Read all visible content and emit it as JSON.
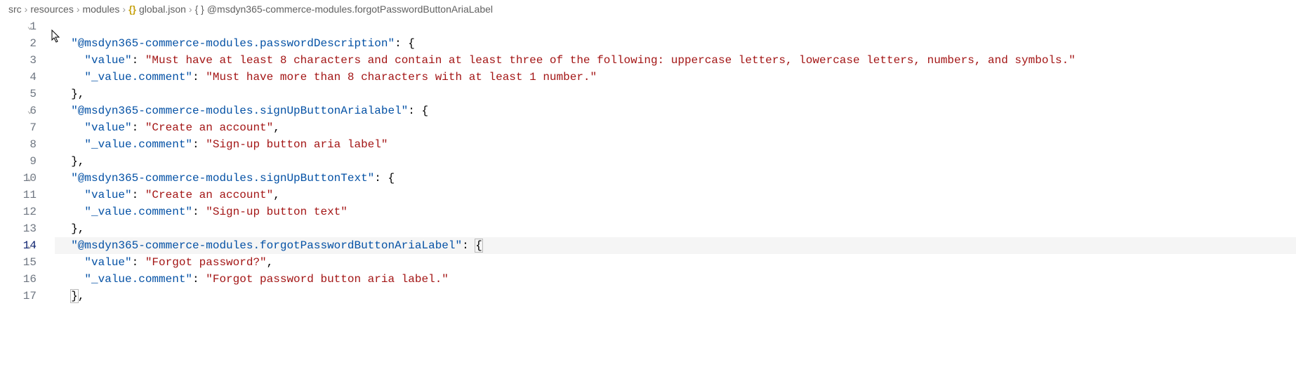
{
  "breadcrumb": {
    "items": [
      {
        "label": "src"
      },
      {
        "label": "resources"
      },
      {
        "label": "modules"
      },
      {
        "label": "global.json",
        "icon": "{}"
      },
      {
        "label": "@msdyn365-commerce-modules.forgotPasswordButtonAriaLabel",
        "icon": "{ }"
      }
    ]
  },
  "editor": {
    "lines": [
      {
        "num": "1",
        "fold": true,
        "tokens": []
      },
      {
        "num": "2",
        "fold": false,
        "tokens": [
          {
            "t": "  ",
            "c": "plain"
          },
          {
            "t": "\"@msdyn365-commerce-modules.passwordDescription\"",
            "c": "key"
          },
          {
            "t": ": ",
            "c": "punct"
          },
          {
            "t": "{",
            "c": "punct"
          }
        ]
      },
      {
        "num": "3",
        "fold": false,
        "tokens": [
          {
            "t": "    ",
            "c": "plain"
          },
          {
            "t": "\"value\"",
            "c": "key"
          },
          {
            "t": ": ",
            "c": "punct"
          },
          {
            "t": "\"Must have at least 8 characters and contain at least three of the following: uppercase letters, lowercase letters, numbers, and symbols.\"",
            "c": "string"
          }
        ]
      },
      {
        "num": "4",
        "fold": false,
        "tokens": [
          {
            "t": "    ",
            "c": "plain"
          },
          {
            "t": "\"_value.comment\"",
            "c": "key"
          },
          {
            "t": ": ",
            "c": "punct"
          },
          {
            "t": "\"Must have more than 8 characters with at least 1 number.\"",
            "c": "string"
          }
        ]
      },
      {
        "num": "5",
        "fold": false,
        "tokens": [
          {
            "t": "  ",
            "c": "plain"
          },
          {
            "t": "},",
            "c": "punct"
          }
        ]
      },
      {
        "num": "6",
        "fold": true,
        "tokens": [
          {
            "t": "  ",
            "c": "plain"
          },
          {
            "t": "\"@msdyn365-commerce-modules.signUpButtonArialabel\"",
            "c": "key"
          },
          {
            "t": ": ",
            "c": "punct"
          },
          {
            "t": "{",
            "c": "punct"
          }
        ]
      },
      {
        "num": "7",
        "fold": false,
        "tokens": [
          {
            "t": "    ",
            "c": "plain"
          },
          {
            "t": "\"value\"",
            "c": "key"
          },
          {
            "t": ": ",
            "c": "punct"
          },
          {
            "t": "\"Create an account\"",
            "c": "string"
          },
          {
            "t": ",",
            "c": "punct"
          }
        ]
      },
      {
        "num": "8",
        "fold": false,
        "tokens": [
          {
            "t": "    ",
            "c": "plain"
          },
          {
            "t": "\"_value.comment\"",
            "c": "key"
          },
          {
            "t": ": ",
            "c": "punct"
          },
          {
            "t": "\"Sign-up button aria label\"",
            "c": "string"
          }
        ]
      },
      {
        "num": "9",
        "fold": false,
        "tokens": [
          {
            "t": "  ",
            "c": "plain"
          },
          {
            "t": "},",
            "c": "punct"
          }
        ]
      },
      {
        "num": "10",
        "fold": true,
        "tokens": [
          {
            "t": "  ",
            "c": "plain"
          },
          {
            "t": "\"@msdyn365-commerce-modules.signUpButtonText\"",
            "c": "key"
          },
          {
            "t": ": ",
            "c": "punct"
          },
          {
            "t": "{",
            "c": "punct"
          }
        ]
      },
      {
        "num": "11",
        "fold": false,
        "tokens": [
          {
            "t": "    ",
            "c": "plain"
          },
          {
            "t": "\"value\"",
            "c": "key"
          },
          {
            "t": ": ",
            "c": "punct"
          },
          {
            "t": "\"Create an account\"",
            "c": "string"
          },
          {
            "t": ",",
            "c": "punct"
          }
        ]
      },
      {
        "num": "12",
        "fold": false,
        "tokens": [
          {
            "t": "    ",
            "c": "plain"
          },
          {
            "t": "\"_value.comment\"",
            "c": "key"
          },
          {
            "t": ": ",
            "c": "punct"
          },
          {
            "t": "\"Sign-up button text\"",
            "c": "string"
          }
        ]
      },
      {
        "num": "13",
        "fold": false,
        "tokens": [
          {
            "t": "  ",
            "c": "plain"
          },
          {
            "t": "},",
            "c": "punct"
          }
        ]
      },
      {
        "num": "14",
        "fold": true,
        "active": true,
        "tokens": [
          {
            "t": "  ",
            "c": "plain"
          },
          {
            "t": "\"@msdyn365-commerce-modules.forgotPasswordButtonAriaLabel\"",
            "c": "key"
          },
          {
            "t": ": ",
            "c": "punct"
          },
          {
            "t": "{",
            "c": "punct",
            "box": true
          }
        ]
      },
      {
        "num": "15",
        "fold": false,
        "tokens": [
          {
            "t": "    ",
            "c": "plain"
          },
          {
            "t": "\"value\"",
            "c": "key"
          },
          {
            "t": ": ",
            "c": "punct"
          },
          {
            "t": "\"Forgot password?\"",
            "c": "string"
          },
          {
            "t": ",",
            "c": "punct"
          }
        ]
      },
      {
        "num": "16",
        "fold": false,
        "tokens": [
          {
            "t": "    ",
            "c": "plain"
          },
          {
            "t": "\"_value.comment\"",
            "c": "key"
          },
          {
            "t": ": ",
            "c": "punct"
          },
          {
            "t": "\"Forgot password button aria label.\"",
            "c": "string"
          }
        ]
      },
      {
        "num": "17",
        "fold": false,
        "tokens": [
          {
            "t": "  ",
            "c": "plain"
          },
          {
            "t": "}",
            "c": "punct",
            "box": true
          },
          {
            "t": ",",
            "c": "punct"
          }
        ]
      }
    ]
  },
  "cursor_glyph": "⬚"
}
